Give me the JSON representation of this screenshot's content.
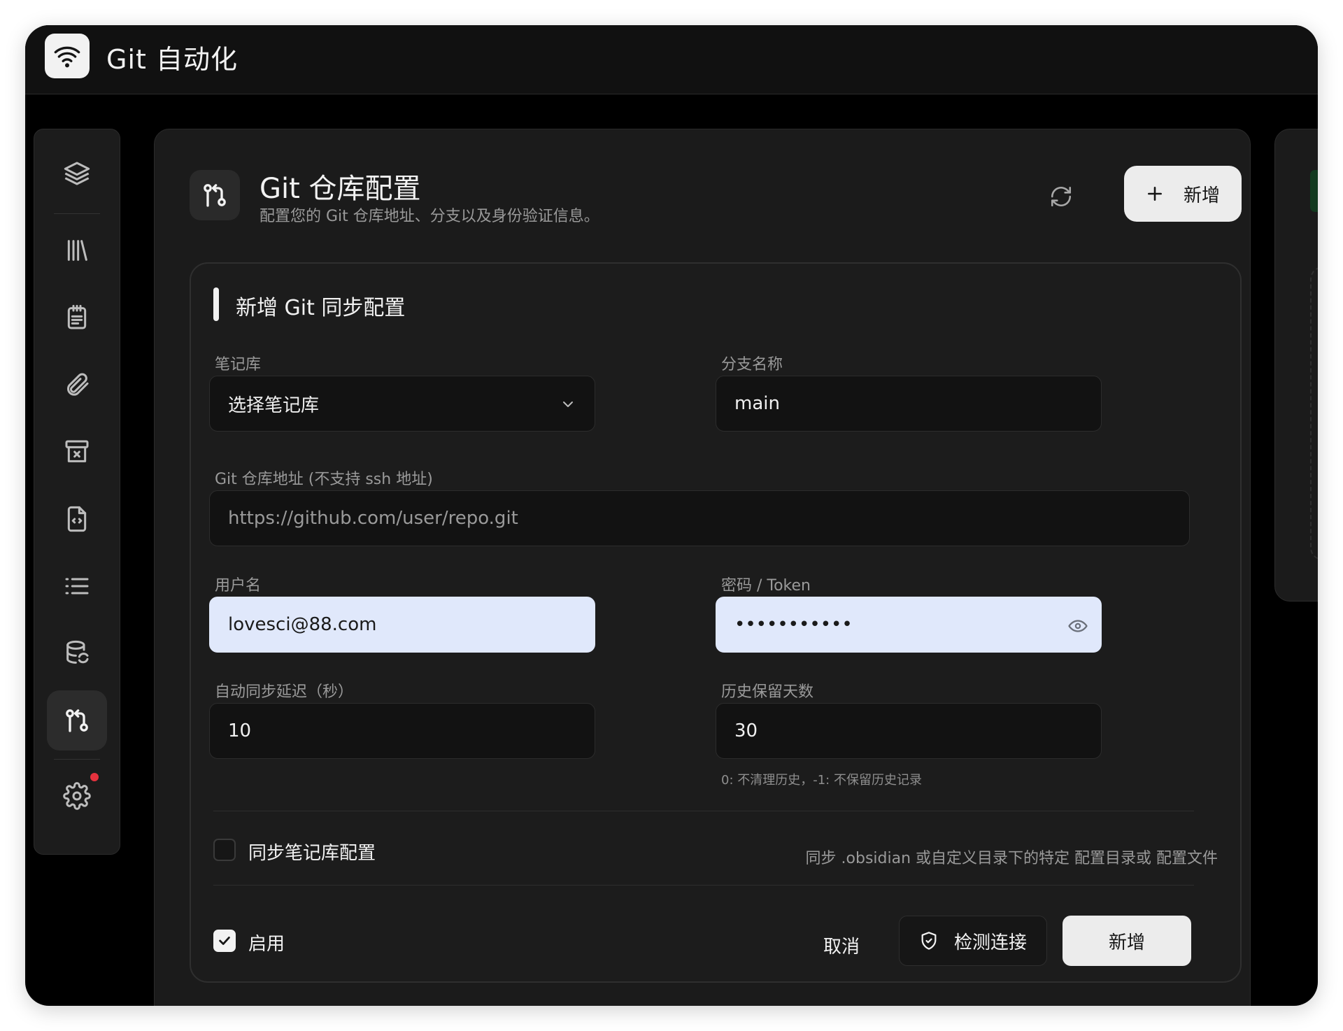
{
  "app": {
    "title": "Git 自动化",
    "icon": "wifi-icon"
  },
  "sidebar": {
    "items": [
      {
        "icon": "layers-icon"
      },
      {
        "icon": "library-icon"
      },
      {
        "icon": "notepad-icon"
      },
      {
        "icon": "paperclip-icon"
      },
      {
        "icon": "archive-x-icon"
      },
      {
        "icon": "file-code-icon"
      },
      {
        "icon": "list-icon"
      },
      {
        "icon": "database-sync-icon"
      },
      {
        "icon": "git-compare-icon",
        "active": true
      },
      {
        "icon": "gear-icon",
        "badge": true
      }
    ]
  },
  "header": {
    "title": "Git 仓库配置",
    "subtitle": "配置您的 Git 仓库地址、分支以及身份验证信息。",
    "add_label": "新增"
  },
  "form": {
    "title": "新增 Git 同步配置",
    "vault": {
      "label": "笔记库",
      "value": "选择笔记库"
    },
    "branch": {
      "label": "分支名称",
      "value": "main"
    },
    "repo": {
      "label": "Git 仓库地址 (不支持 ssh 地址)",
      "placeholder": "https://github.com/user/repo.git"
    },
    "username": {
      "label": "用户名",
      "value": "lovesci@88.com"
    },
    "password": {
      "label": "密码 / Token",
      "value": "•••••••••••"
    },
    "delay": {
      "label": "自动同步延迟（秒）",
      "value": "10"
    },
    "history": {
      "label": "历史保留天数",
      "value": "30",
      "hint": "0: 不清理历史，-1: 不保留历史记录"
    },
    "sync_config": {
      "label": "同步笔记库配置",
      "checked": false,
      "description": "同步 .obsidian 或自定义目录下的特定 配置目录或 配置文件"
    },
    "enabled": {
      "label": "启用",
      "checked": true
    },
    "buttons": {
      "cancel": "取消",
      "test": "检测连接",
      "submit": "新增"
    }
  },
  "colors": {
    "background": "#000000",
    "panel": "#1b1b1b",
    "input_filled": "#e0e8fb",
    "accent_button": "#ececec",
    "badge": "#e5323e"
  }
}
